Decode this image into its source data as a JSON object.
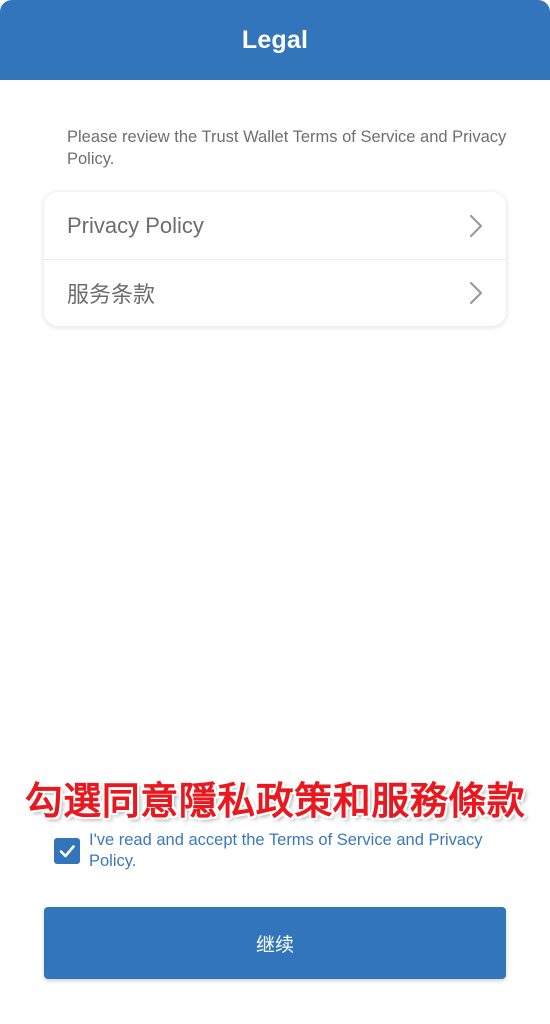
{
  "header": {
    "title": "Legal"
  },
  "intro": {
    "text": "Please review the Trust Wallet Terms of Service and Privacy Policy."
  },
  "legal_items": [
    {
      "label": "Privacy Policy",
      "icon": "chevron-right-icon"
    },
    {
      "label": "服务条款",
      "icon": "chevron-right-icon"
    }
  ],
  "overlay_caption": "勾選同意隱私政策和服務條款",
  "consent": {
    "checked": true,
    "label": "I've read and accept the Terms of Service and Privacy Policy."
  },
  "continue_button": {
    "label": "继续"
  },
  "colors": {
    "primary": "#3375bb",
    "caption_red": "#e8181e",
    "muted_text": "#6f6f6f"
  }
}
